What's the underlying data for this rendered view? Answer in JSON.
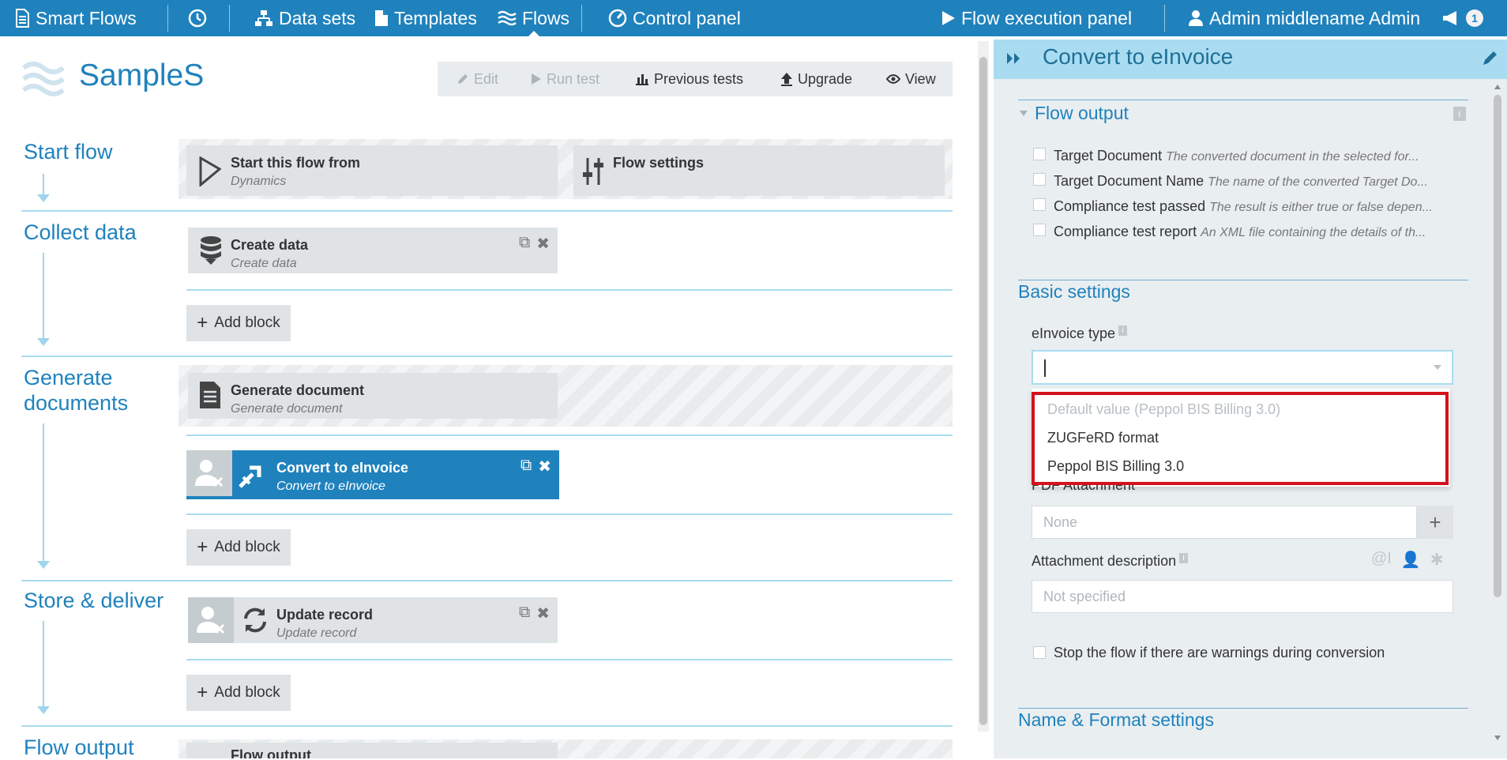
{
  "nav": {
    "brand": "Smart Flows",
    "data_sets": "Data sets",
    "templates": "Templates",
    "flows": "Flows",
    "control_panel": "Control panel",
    "execution_panel": "Flow execution panel",
    "user": "Admin middlename Admin",
    "notification_count": "1"
  },
  "flow": {
    "title": "SampleS",
    "toolbar": {
      "edit": "Edit",
      "run_test": "Run test",
      "previous_tests": "Previous tests",
      "upgrade": "Upgrade",
      "view": "View"
    }
  },
  "sections": {
    "start": "Start flow",
    "collect": "Collect data",
    "generate_1": "Generate",
    "generate_2": "documents",
    "store": "Store & deliver",
    "output": "Flow output"
  },
  "blocks": {
    "start_from": {
      "title": "Start this flow from",
      "sub": "Dynamics"
    },
    "flow_settings": {
      "title": "Flow settings"
    },
    "create_data": {
      "title": "Create data",
      "sub": "Create data"
    },
    "generate_document": {
      "title": "Generate document",
      "sub": "Generate document"
    },
    "convert": {
      "title": "Convert to eInvoice",
      "sub": "Convert to eInvoice"
    },
    "update_record": {
      "title": "Update record",
      "sub": "Update record"
    },
    "flow_output": {
      "title": "Flow output"
    }
  },
  "add_block_label": "Add block",
  "panel": {
    "title": "Convert to eInvoice",
    "flow_output_title": "Flow output",
    "outputs": [
      {
        "name": "Target Document",
        "desc": "The converted document in the selected for..."
      },
      {
        "name": "Target Document Name",
        "desc": "The name of the converted Target Do..."
      },
      {
        "name": "Compliance test passed",
        "desc": "The result is either true or false depen..."
      },
      {
        "name": "Compliance test report",
        "desc": "An XML file containing the details of th..."
      }
    ],
    "basic_settings": "Basic settings",
    "einvoice_type_label": "eInvoice type",
    "einvoice_options": [
      "Default value (Peppol BIS Billing 3.0)",
      "ZUGFeRD format",
      "Peppol BIS Billing 3.0"
    ],
    "pdf_attachment_label": "PDF Attachment",
    "pdf_attachment_value": "None",
    "attachment_desc_label": "Attachment description",
    "attachment_desc_placeholder": "Not specified",
    "stop_on_warnings": "Stop the flow if there are warnings during conversion",
    "name_format": "Name & Format settings"
  },
  "colors": {
    "primary": "#1f82bd",
    "panel_header": "#a9dcf0",
    "highlight": "#d4121c"
  }
}
